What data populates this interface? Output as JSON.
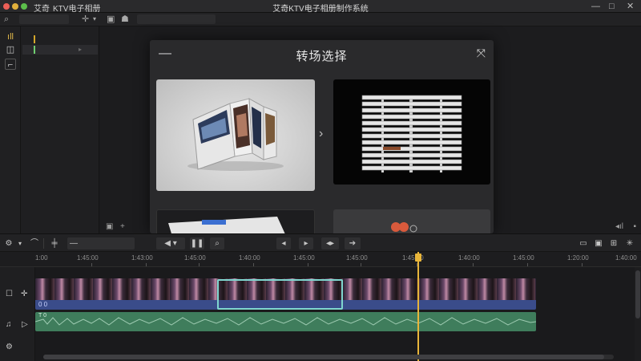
{
  "titlebar": {
    "menus": [
      "艾奇",
      "KTV电子相册"
    ],
    "title": "艾奇KTV电子相册制作系统",
    "controls": [
      "—",
      "□",
      "✕"
    ]
  },
  "topbar": {
    "search_icon": "search-icon",
    "field_a": "",
    "field_b": "",
    "field_c": ""
  },
  "left_list": {
    "rows": [
      {
        "label": "",
        "mark_color": "#d4a62a"
      },
      {
        "label": "",
        "mark_color": "#6fcf6f"
      }
    ]
  },
  "modal": {
    "minimize": "—",
    "title": "转场选择",
    "expand_icon": "expand-icon",
    "next_icon": "chevron-right-icon",
    "transitions": [
      {
        "name": "",
        "style": "book-fold"
      },
      {
        "name": "",
        "style": "blinds"
      },
      {
        "name": "",
        "style": "slide"
      },
      {
        "name": "",
        "style": "hearts"
      }
    ]
  },
  "timeline": {
    "ruler_labels": [
      "1:00",
      "1:45:00",
      "1:43:00",
      "1:45:00",
      "1:40:00",
      "1:45:00",
      "1:45:00",
      "1:45:00",
      "1:40:00",
      "1:45:00",
      "1:20:00",
      "1:40:00"
    ],
    "playhead_label": "1:40:00",
    "video_clip_tag": "0 0",
    "audio_label": "T 0",
    "colors": {
      "video_clip": "#3a4c8a",
      "audio_clip": "#3f7d5c",
      "playhead": "#e8b53a",
      "selection": "#7fd6cf"
    }
  }
}
